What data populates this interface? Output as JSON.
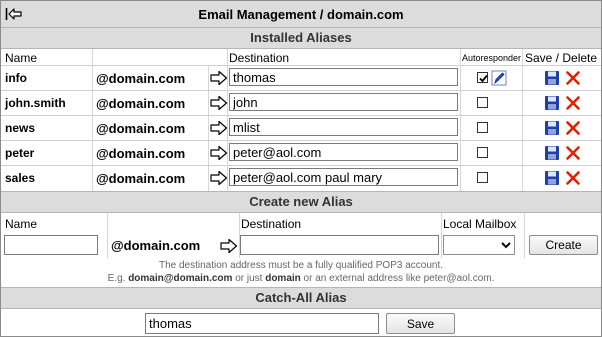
{
  "header": {
    "title": "Email Management / domain.com"
  },
  "installed": {
    "section_title": "Installed Aliases",
    "col_name": "Name",
    "col_destination": "Destination",
    "col_autoresponder": "Autoresponder",
    "col_save_delete": "Save / Delete",
    "domain_suffix": "@domain.com",
    "rows": [
      {
        "name": "info",
        "destination": "thomas",
        "autoresponder": true
      },
      {
        "name": "john.smith",
        "destination": "john",
        "autoresponder": false
      },
      {
        "name": "news",
        "destination": "mlist",
        "autoresponder": false
      },
      {
        "name": "peter",
        "destination": "peter@aol.com",
        "autoresponder": false
      },
      {
        "name": "sales",
        "destination": "peter@aol.com paul mary",
        "autoresponder": false
      }
    ]
  },
  "create": {
    "section_title": "Create new Alias",
    "col_name": "Name",
    "col_destination": "Destination",
    "col_local_mailbox": "Local Mailbox",
    "domain_suffix": "@domain.com",
    "name_value": "",
    "destination_value": "",
    "mailbox_value": "",
    "create_label": "Create",
    "note_line1": "The destination address must be a fully qualified POP3 account.",
    "note_prefix": "E.g. ",
    "note_ex1": "domain@domain.com",
    "note_mid": " or just ",
    "note_ex2": "domain",
    "note_suffix": " or an external address like peter@aol.com."
  },
  "catchall": {
    "section_title": "Catch-All Alias",
    "value": "thomas",
    "save_label": "Save"
  },
  "colors": {
    "section_bg": "#dcdcdc",
    "save_icon": "#1f3fa6",
    "delete_icon": "#e02000"
  },
  "icons": {
    "back": "back-arrow-icon",
    "arrow": "right-arrow-icon",
    "save": "floppy-disk-icon",
    "delete": "delete-x-icon",
    "edit": "pencil-icon"
  }
}
